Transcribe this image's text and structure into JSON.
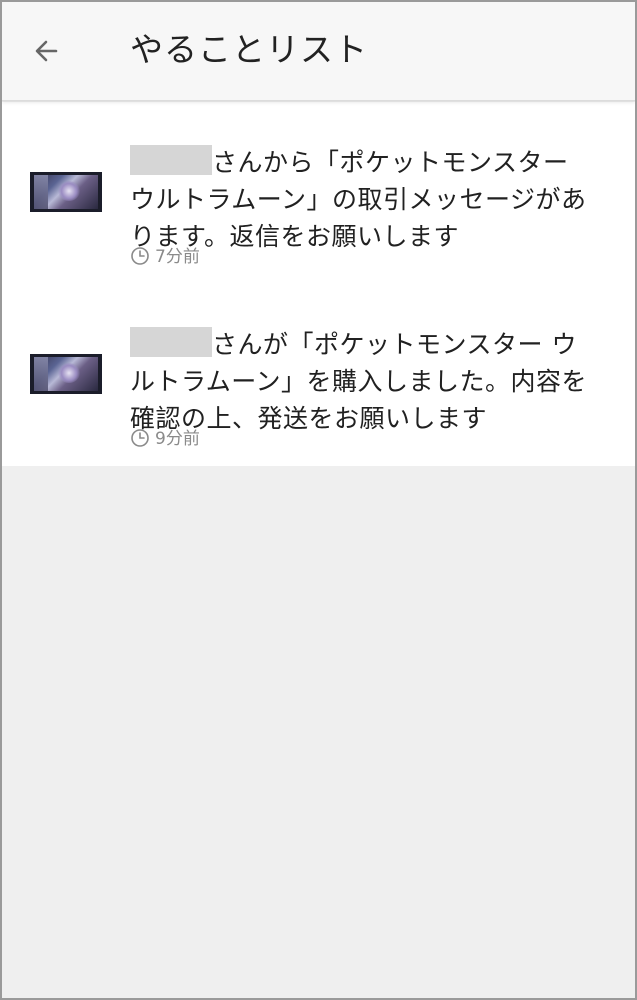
{
  "header": {
    "title": "やることリスト",
    "back_icon": "arrow-back-icon"
  },
  "todos": [
    {
      "sender": "",
      "message_line1": "さんから「ポケットモンスター",
      "message_line2": "ウルトラムーン」の取引メッセージがあ",
      "message_line3": "ります。返信をお願いします",
      "time": "7分前",
      "thumb_icon": "product-thumbnail"
    },
    {
      "sender": "",
      "message_line1": "さんが「ポケットモンスター ウ",
      "message_line2": "ルトラムーン」を購入しました。内容を",
      "message_line3": "確認の上、発送をお願いします",
      "time": "9分前",
      "thumb_icon": "product-thumbnail"
    }
  ],
  "colors": {
    "header_bg": "#f7f7f7",
    "page_bg": "#efefef",
    "text": "#212121",
    "muted": "#8a8a8a"
  }
}
